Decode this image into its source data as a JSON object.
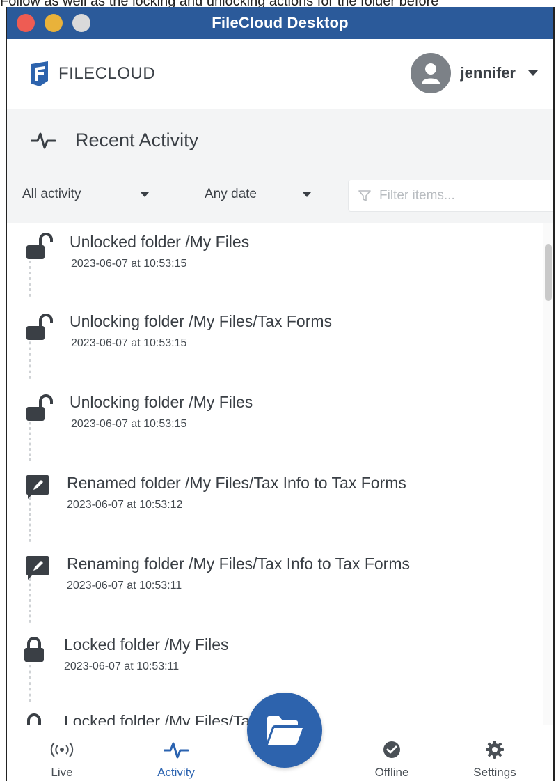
{
  "caption": "Follow as well as the locking and unlocking actions for the folder before",
  "window": {
    "title": "FileCloud Desktop"
  },
  "header": {
    "logo_text": "FILECLOUD",
    "username": "jennifer"
  },
  "section": {
    "title": "Recent Activity",
    "icon": "activity-pulse-icon"
  },
  "filters": {
    "activity_value": "All activity",
    "date_value": "Any date",
    "search_placeholder": "Filter items..."
  },
  "activity": [
    {
      "icon": "unlock-icon",
      "title": "Unlocked folder /My Files",
      "time": "2023-06-07 at 10:53:15"
    },
    {
      "icon": "unlock-icon",
      "title": "Unlocking folder /My Files/Tax Forms",
      "time": "2023-06-07 at 10:53:15"
    },
    {
      "icon": "unlock-icon",
      "title": "Unlocking folder /My Files",
      "time": "2023-06-07 at 10:53:15"
    },
    {
      "icon": "rename-icon",
      "title": "Renamed folder /My Files/Tax Info to Tax Forms",
      "time": "2023-06-07 at 10:53:12"
    },
    {
      "icon": "rename-icon",
      "title": "Renaming folder /My Files/Tax Info to Tax Forms",
      "time": "2023-06-07 at 10:53:11"
    },
    {
      "icon": "lock-icon",
      "title": "Locked folder /My Files",
      "time": "2023-06-07 at 10:53:11"
    },
    {
      "icon": "lock-icon",
      "title": "Locked folder /My Files/Tax Info",
      "time": ""
    }
  ],
  "nav": {
    "live": "Live",
    "activity": "Activity",
    "offline": "Offline",
    "settings": "Settings"
  },
  "colors": {
    "titlebar": "#2b5a9a",
    "accent": "#2d63ad",
    "panel": "#f3f4f5"
  }
}
